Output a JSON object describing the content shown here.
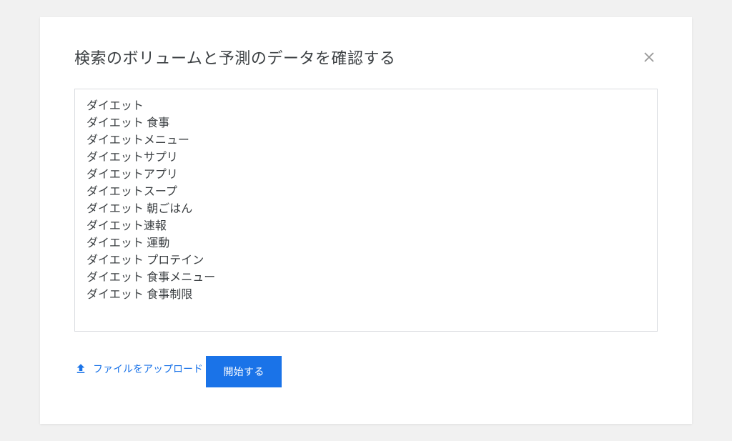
{
  "header": {
    "title": "検索のボリュームと予測のデータを確認する"
  },
  "keywords": [
    "ダイエット",
    "ダイエット 食事",
    "ダイエットメニュー",
    "ダイエットサプリ",
    "ダイエットアプリ",
    "ダイエットスープ",
    "ダイエット 朝ごはん",
    "ダイエット速報",
    "ダイエット 運動",
    "ダイエット プロテイン",
    "ダイエット 食事メニュー",
    "ダイエット 食事制限"
  ],
  "upload": {
    "label": "ファイルをアップロード"
  },
  "button": {
    "start_label": "開始する"
  }
}
